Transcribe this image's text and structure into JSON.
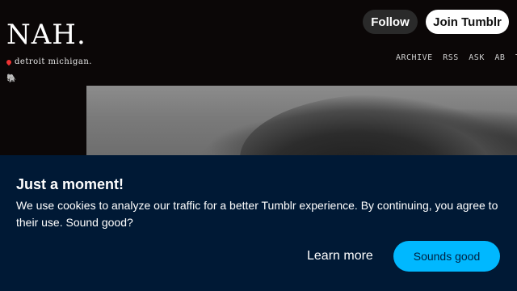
{
  "blog": {
    "title": "NAH.",
    "location": "detroit michigan.",
    "emoji": "🐘"
  },
  "header": {
    "follow_label": "Follow",
    "join_label": "Join Tumblr"
  },
  "nav": {
    "items": [
      "ARCHIVE",
      "RSS",
      "ASK",
      "AB",
      "TH"
    ]
  },
  "cookie_banner": {
    "title": "Just a moment!",
    "message": "We use cookies to analyze our traffic for a better Tumblr experience. By continuing, you agree to their use. Sound good?",
    "learn_more_label": "Learn more",
    "accept_label": "Sounds good"
  },
  "colors": {
    "background": "#0b0707",
    "banner": "#001935",
    "accept_button": "#00b8ff"
  }
}
